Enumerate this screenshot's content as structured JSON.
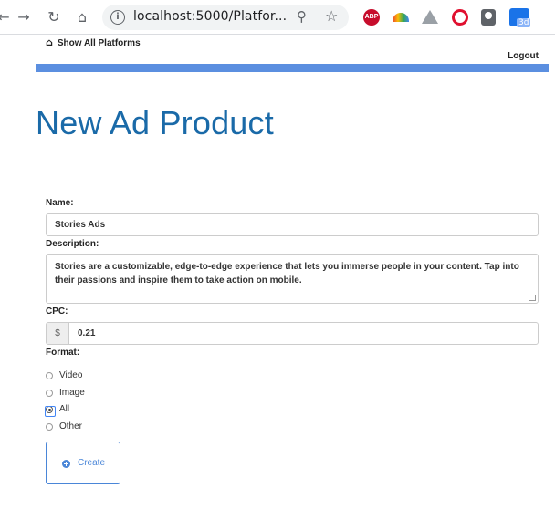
{
  "browser": {
    "url": "localhost:5000/Platfor...",
    "back_icon": "arrow-left",
    "forward_icon": "arrow-right",
    "reload_icon": "reload",
    "home_icon": "home",
    "extensions": [
      "adblock-plus",
      "rainbow-extension",
      "google-drive",
      "opera-shield",
      "lightbulb",
      "3d-extension"
    ],
    "ext_3d_label": "3d",
    "abp_label": "ABP"
  },
  "nav": {
    "home_link": "Show All Platforms",
    "logout": "Logout"
  },
  "colors": {
    "accent_bar": "#5b8fe0",
    "title": "#1a6aa8",
    "button": "#4a86d8"
  },
  "page": {
    "title": "New Ad Product"
  },
  "form": {
    "name_label": "Name:",
    "name_value": "Stories Ads",
    "description_label": "Description:",
    "description_value": "Stories are a customizable, edge-to-edge experience that lets you immerse people in your content. Tap into their passions and inspire them to take action on mobile.",
    "cpc_label": "CPC:",
    "cpc_prefix": "$",
    "cpc_value": "0.21",
    "format_label": "Format:",
    "format_options": [
      {
        "label": "Video",
        "checked": false
      },
      {
        "label": "Image",
        "checked": false
      },
      {
        "label": "All",
        "checked": true
      },
      {
        "label": "Other",
        "checked": false
      }
    ],
    "create_label": "Create"
  }
}
